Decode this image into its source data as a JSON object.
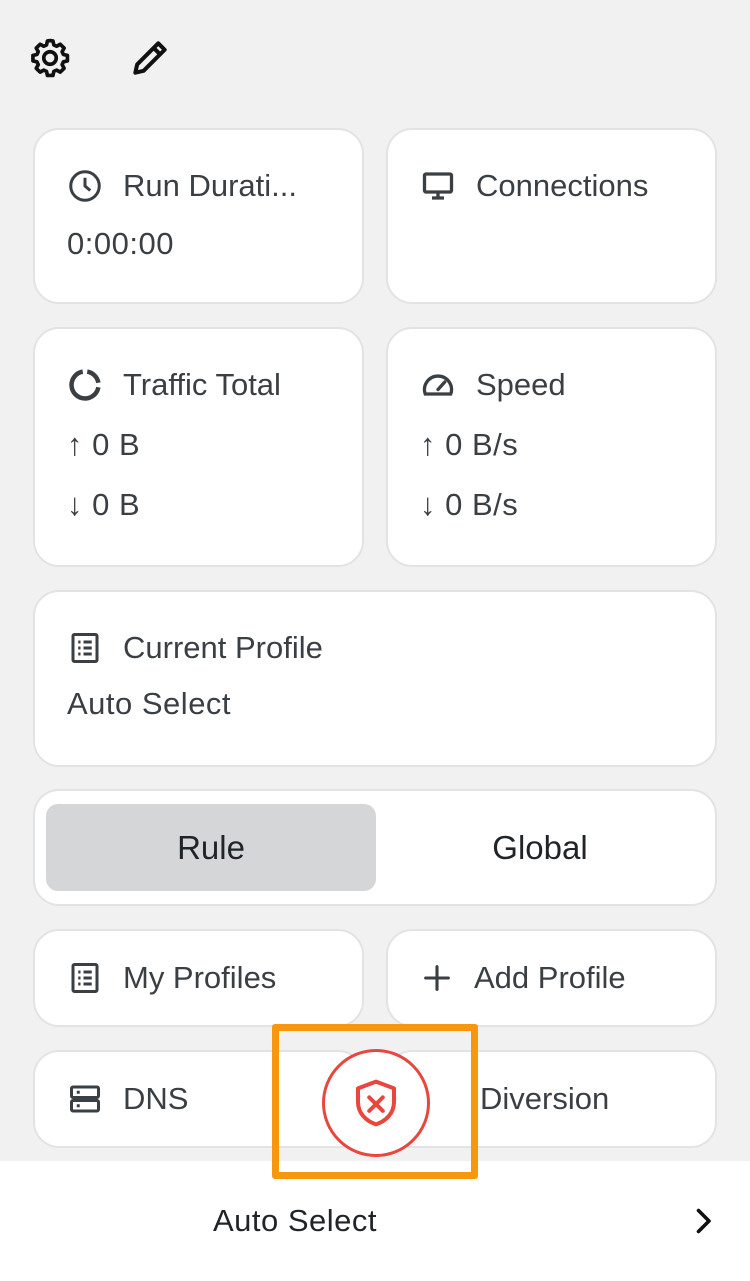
{
  "toolbar": {
    "settings_icon": "gear-icon",
    "edit_icon": "pencil-icon"
  },
  "run_duration": {
    "icon": "clock-icon",
    "title": "Run Durati...",
    "value": "0:00:00"
  },
  "connections": {
    "icon": "monitor-icon",
    "title": "Connections"
  },
  "traffic_total": {
    "icon": "ring-chart-icon",
    "title": "Traffic Total",
    "upload": "↑ 0 B",
    "download": "↓ 0 B"
  },
  "speed": {
    "icon": "speedometer-icon",
    "title": "Speed",
    "upload": "↑ 0 B/s",
    "download": "↓ 0 B/s"
  },
  "current_profile": {
    "icon": "list-icon",
    "title": "Current Profile",
    "value": "Auto Select"
  },
  "mode": {
    "options": [
      "Rule",
      "Global"
    ],
    "selected": "Rule"
  },
  "actions": {
    "my_profiles": "My Profiles",
    "add_profile": "Add Profile",
    "dns": "DNS",
    "diversion": "Diversion"
  },
  "bottom_bar": {
    "selected_node": "Auto Select"
  },
  "colors": {
    "accent_red": "#e8473d",
    "highlight_orange": "#f7970d",
    "background": "#f1f1f2",
    "mode_active": "#d5d6d8"
  }
}
